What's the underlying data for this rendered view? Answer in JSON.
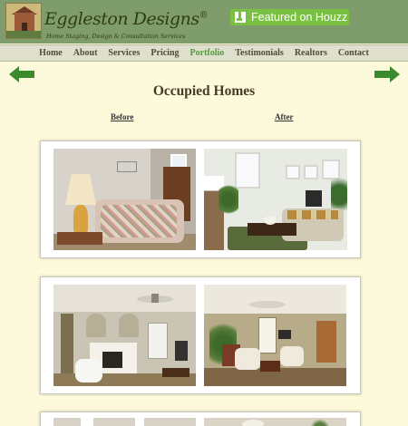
{
  "header": {
    "brand": "Eggleston Designs",
    "registered": "®",
    "tagline": "Home Staging, Design & Consultation Services",
    "houzz_label": "Featured on Houzz"
  },
  "nav": {
    "items": [
      {
        "label": "Home",
        "active": false
      },
      {
        "label": "About",
        "active": false
      },
      {
        "label": "Services",
        "active": false
      },
      {
        "label": "Pricing",
        "active": false
      },
      {
        "label": "Portfolio",
        "active": true
      },
      {
        "label": "Testimonials",
        "active": false
      },
      {
        "label": "Realtors",
        "active": false
      },
      {
        "label": "Contact",
        "active": false
      }
    ]
  },
  "page": {
    "title": "Occupied Homes",
    "before_label": "Before",
    "after_label": "After"
  },
  "colors": {
    "header_bg": "#7f9c6c",
    "page_bg": "#fdfadb",
    "nav_active": "#4f9b3a",
    "arrow": "#3c8a2e",
    "houzz": "#7ac143"
  },
  "icons": {
    "prev": "arrow-left-icon",
    "next": "arrow-right-icon",
    "houzz": "houzz-icon",
    "logo": "logo-image"
  }
}
